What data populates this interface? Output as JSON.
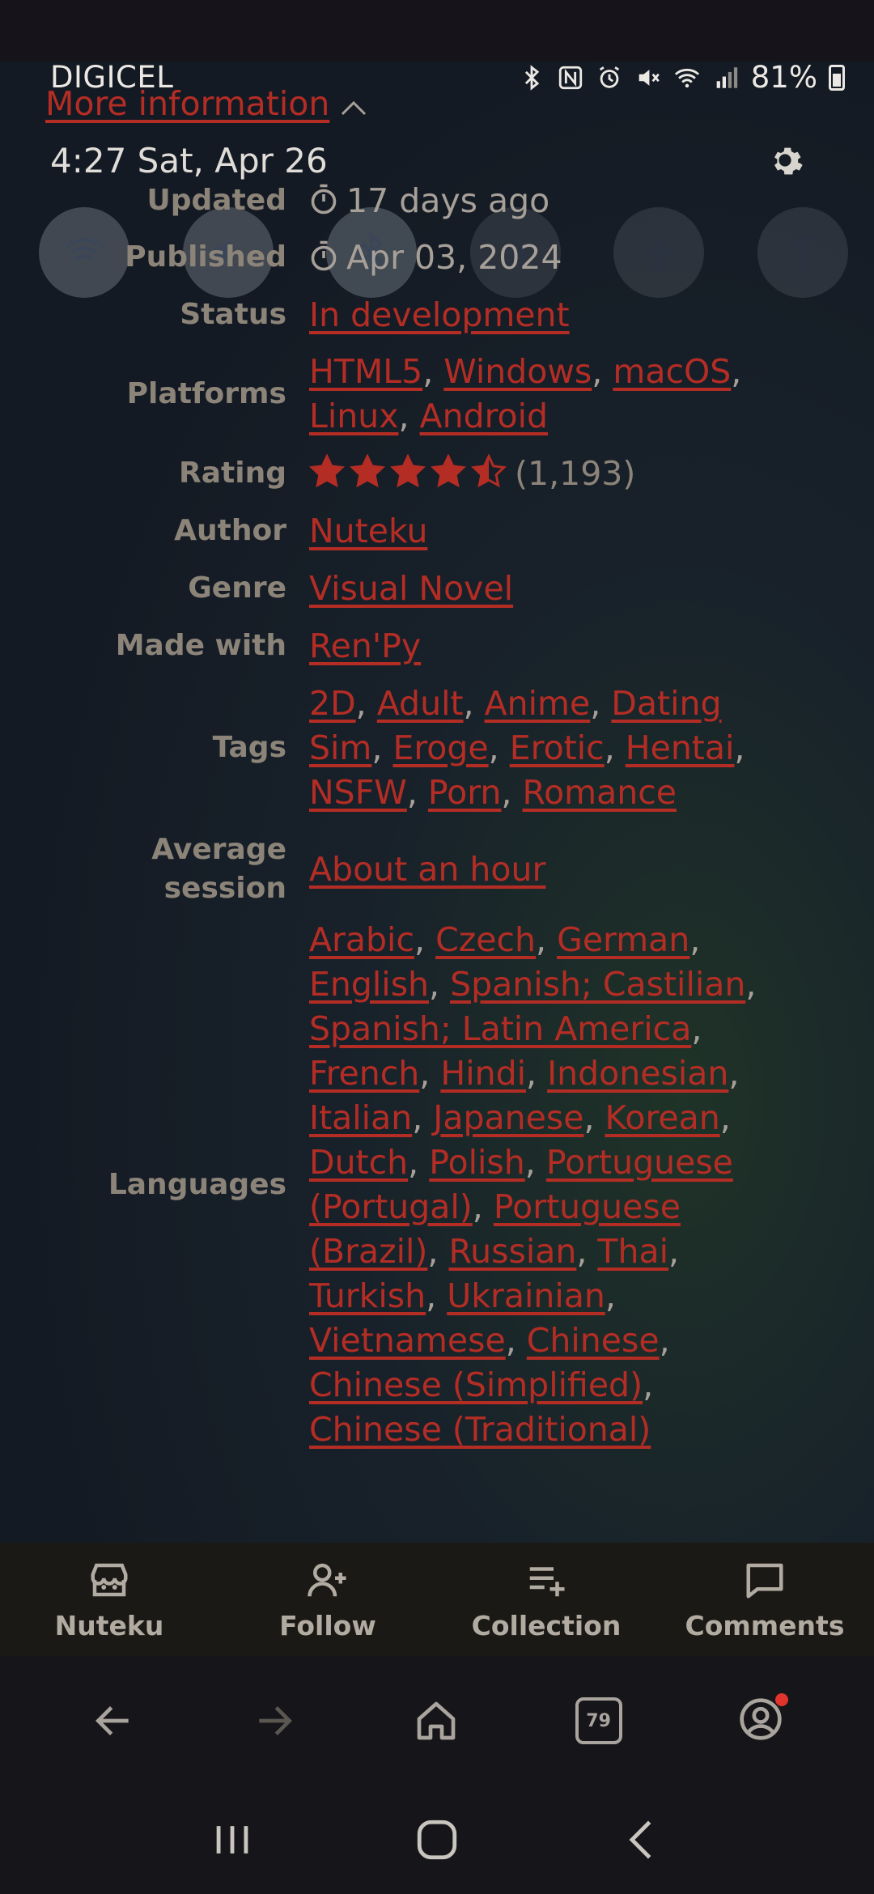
{
  "status_bar": {
    "carrier": "DIGICEL",
    "battery": "81%",
    "time_date": "4:27  Sat, Apr 26"
  },
  "header": {
    "more_information": "More information"
  },
  "info": {
    "updated_label": "Updated",
    "updated_value": "17 days ago",
    "published_label": "Published",
    "published_value": "Apr 03, 2024",
    "status_label": "Status",
    "status_value": "In development",
    "platforms_label": "Platforms",
    "platforms": [
      "HTML5",
      "Windows",
      "macOS",
      "Linux",
      "Android"
    ],
    "rating_label": "Rating",
    "rating_value": 4.5,
    "rating_count": "(1,193)",
    "author_label": "Author",
    "author_value": "Nuteku",
    "genre_label": "Genre",
    "genre_value": "Visual Novel",
    "made_with_label": "Made with",
    "made_with_value": "Ren'Py",
    "tags_label": "Tags",
    "tags": [
      "2D",
      "Adult",
      "Anime",
      "Dating Sim",
      "Eroge",
      "Erotic",
      "Hentai",
      "NSFW",
      "Porn",
      "Romance"
    ],
    "session_label_1": "Average",
    "session_label_2": "session",
    "session_value": "About an hour",
    "languages_label": "Languages",
    "languages": [
      "Arabic",
      "Czech",
      "German",
      "English",
      "Spanish; Castilian",
      "Spanish; Latin America",
      "French",
      "Hindi",
      "Indonesian",
      "Italian",
      "Japanese",
      "Korean",
      "Dutch",
      "Polish",
      "Portuguese (Portugal)",
      "Portuguese (Brazil)",
      "Russian",
      "Thai",
      "Turkish",
      "Ukrainian",
      "Vietnamese",
      "Chinese",
      "Chinese (Simplified)",
      "Chinese (Traditional)"
    ]
  },
  "actions": {
    "author": "Nuteku",
    "follow": "Follow",
    "collection": "Collection",
    "comments": "Comments"
  },
  "browser": {
    "tab_count": "79"
  },
  "colors": {
    "link": "#b42d25",
    "label": "#8c8479",
    "background": "#141a23"
  }
}
